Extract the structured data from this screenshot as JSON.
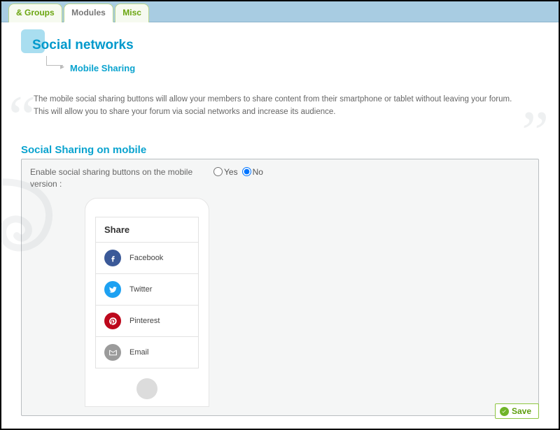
{
  "tabs": {
    "groups": "& Groups",
    "modules": "Modules",
    "misc": "Misc"
  },
  "title": {
    "main": "Social networks",
    "sub": "Mobile Sharing"
  },
  "description": "The mobile social sharing buttons will allow your members to share content from their smartphone or tablet without leaving your forum. This will allow you to share your forum via social networks and increase its audience.",
  "section": {
    "heading": "Social Sharing on mobile",
    "option_label": "Enable social sharing buttons on the mobile version :",
    "yes": "Yes",
    "no": "No",
    "selected": "no"
  },
  "share_preview": {
    "header": "Share",
    "items": [
      "Facebook",
      "Twitter",
      "Pinterest",
      "Email"
    ]
  },
  "save_button": "Save"
}
